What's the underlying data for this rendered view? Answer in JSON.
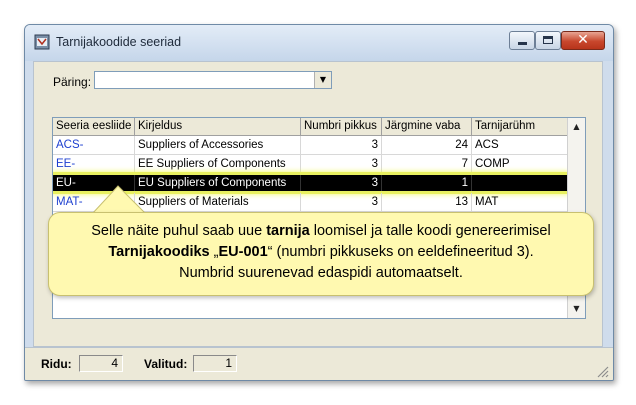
{
  "window": {
    "title": "Tarnijakoodide seeriad"
  },
  "query": {
    "label": "Päring:",
    "value": ""
  },
  "grid": {
    "columns": [
      "Seeria eesliide",
      "Kirjeldus",
      "Numbri pikkus",
      "Järgmine vaba",
      "Tarnijarühm"
    ],
    "rows": [
      {
        "prefix": "ACS-",
        "description": "Suppliers of Accessories",
        "length": "3",
        "next": "24",
        "group": "ACS"
      },
      {
        "prefix": "EE-",
        "description": "EE Suppliers of Components",
        "length": "3",
        "next": "7",
        "group": "COMP"
      },
      {
        "prefix": "EU-",
        "description": "EU Suppliers of Components",
        "length": "3",
        "next": "1",
        "group": ""
      },
      {
        "prefix": "MAT-",
        "description": "Suppliers of Materials",
        "length": "3",
        "next": "13",
        "group": "MAT"
      }
    ],
    "selected_row": 2
  },
  "status": {
    "rows_label": "Ridu:",
    "rows_value": "4",
    "selected_label": "Valitud:",
    "selected_value": "1"
  },
  "callout": {
    "line1_a": "Selle näite puhul saab uue ",
    "line1_b": "tarnija",
    "line1_c": " loomisel ja talle koodi genereerimisel",
    "line2_a": "Tarnijakoodiks",
    "line2_b": " „",
    "line2_c": "EU-001",
    "line2_d": "“ (numbri pikkuseks on eeldefineeritud 3).",
    "line3": "Numbrid suurenevad edaspidi automaatselt."
  },
  "colors": {
    "code_link": "#1d3fd0",
    "selection": "#000000",
    "highlight": "#e8f060",
    "callout_bg": "#fff9b0"
  }
}
